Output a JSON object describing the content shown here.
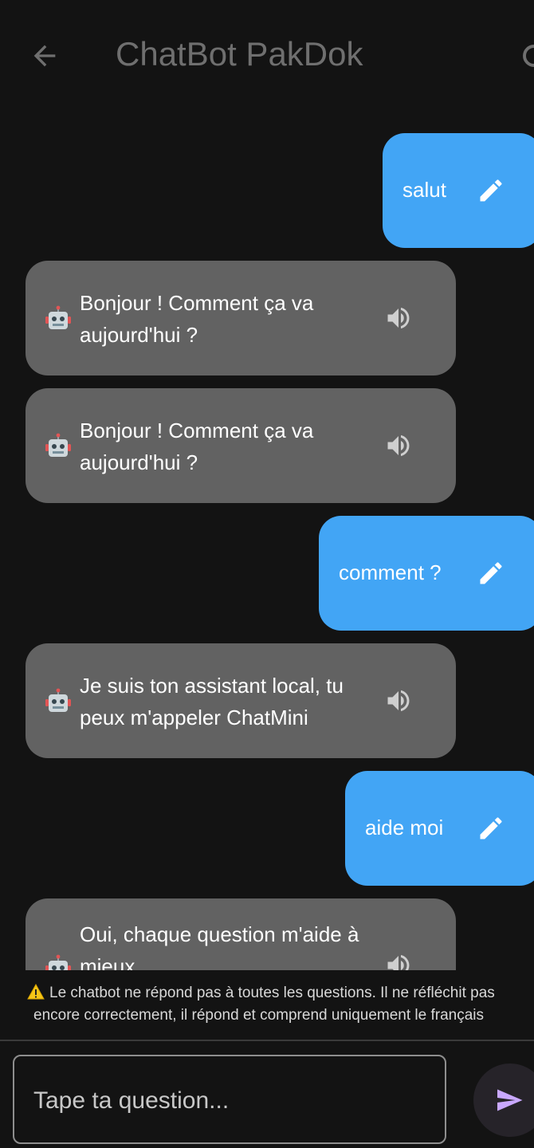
{
  "app_bar": {
    "title": "ChatBot PakDok",
    "back_icon": "arrow-left-icon",
    "action_icon": "partially-visible-icon"
  },
  "messages": [
    {
      "role": "user",
      "text": "salut",
      "icon": "pencil-icon"
    },
    {
      "role": "bot",
      "text": "Bonjour ! Comment ça va aujourd'hui ?",
      "icon": "speaker-icon",
      "avatar": "robot-icon"
    },
    {
      "role": "bot",
      "text": "Bonjour ! Comment ça va aujourd'hui ?",
      "icon": "speaker-icon",
      "avatar": "robot-icon"
    },
    {
      "role": "user",
      "text": "comment ?",
      "icon": "pencil-icon"
    },
    {
      "role": "bot",
      "text": "Je suis ton assistant local, tu peux m'appeler ChatMini",
      "icon": "speaker-icon",
      "avatar": "robot-icon"
    },
    {
      "role": "user",
      "text": "aide moi",
      "icon": "pencil-icon"
    },
    {
      "role": "bot",
      "text": "Oui, chaque question m'aide à mieux",
      "icon": "speaker-icon",
      "avatar": "robot-icon"
    }
  ],
  "warning": {
    "line1": "Le chatbot ne répond pas à toutes les questions. Il ne réfléchit pas",
    "line2": "encore correctement, il répond et comprend uniquement le français"
  },
  "composer": {
    "placeholder": "Tape ta question...",
    "value": "",
    "send_icon": "send-icon"
  },
  "colors": {
    "background": "#131313",
    "user_bubble": "#42a5f5",
    "bot_bubble": "#626262",
    "send_accent": "#c9a8ff"
  }
}
